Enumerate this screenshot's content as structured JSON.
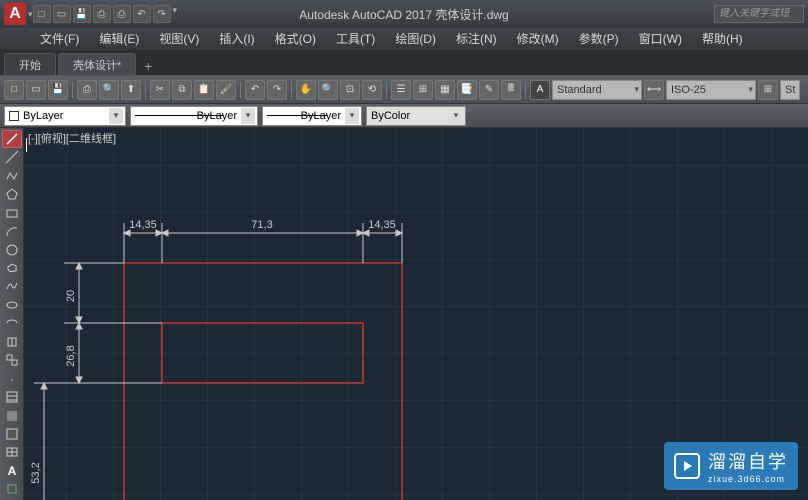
{
  "title": "Autodesk AutoCAD 2017    壳体设计.dwg",
  "search_placeholder": "键入关键字或短",
  "menu": [
    "文件(F)",
    "编辑(E)",
    "视图(V)",
    "插入(I)",
    "格式(O)",
    "工具(T)",
    "绘图(D)",
    "标注(N)",
    "修改(M)",
    "参数(P)",
    "窗口(W)",
    "帮助(H)"
  ],
  "tabs": {
    "start": "开始",
    "active": "壳体设计*"
  },
  "toolbar": {
    "style_dropdown": "Standard",
    "dim_dropdown": "ISO-25",
    "st_label": "St"
  },
  "layer": {
    "bylayer1": "ByLayer",
    "bylayer2": "ByLayer",
    "bylayer3": "ByLayer",
    "bycolor": "ByColor"
  },
  "view_label": "[-][俯视][二维线框]",
  "dimensions": {
    "d1": "14,35",
    "d2": "71,3",
    "d3": "14,35",
    "v1": "20",
    "v2": "26,8",
    "v3": "53,2"
  },
  "watermark": {
    "brand": "溜溜自学",
    "url": "zixue.3d66.com"
  }
}
